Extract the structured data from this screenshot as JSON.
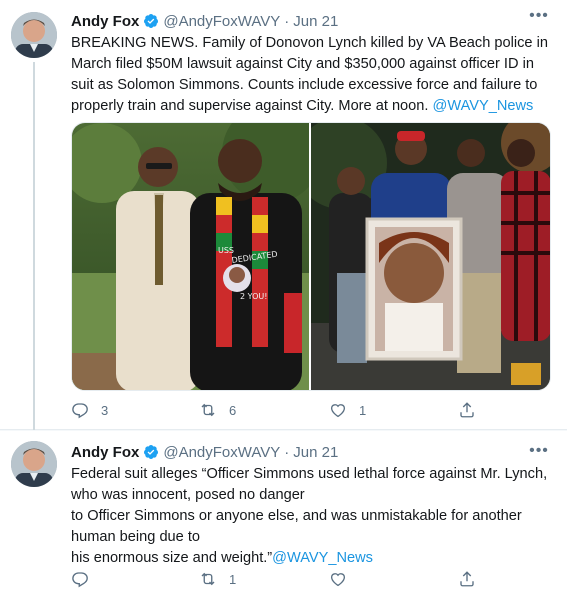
{
  "tweets": [
    {
      "author": {
        "name": "Andy Fox",
        "handle": "@AndyFoxWAVY",
        "date": "Jun 21",
        "verified": true
      },
      "text_lines": [
        "BREAKING NEWS. Family of Donovon Lynch killed by VA Beach police in",
        "March filed $50M lawsuit against City and $350,000 against officer ID in",
        "suit as Solomon Simmons. Counts include excessive force and failure to",
        "properly train and supervise against City. More at noon."
      ],
      "mention": "@WAVY_News",
      "image_text": [
        "USS",
        "DEDICATED",
        "2 YOU!"
      ],
      "actions": {
        "replies": "3",
        "retweets": "6",
        "likes": "1"
      }
    },
    {
      "author": {
        "name": "Andy Fox",
        "handle": "@AndyFoxWAVY",
        "date": "Jun 21",
        "verified": true
      },
      "text_lines": [
        "Federal suit alleges “Officer Simmons used lethal force against Mr. Lynch,",
        "who was innocent, posed no danger",
        "to Officer Simmons or anyone else, and was unmistakable for another",
        "human being due to",
        "his enormous size and weight.”"
      ],
      "mention": "@WAVY_News",
      "actions": {
        "replies": "",
        "retweets": "1",
        "likes": ""
      }
    }
  ],
  "ui": {
    "separator": "·",
    "more_glyph": "•••"
  },
  "colors": {
    "accent": "#1da1f2",
    "link": "#1b95e0",
    "muted": "#5b7083",
    "border": "#e6ecf0"
  }
}
